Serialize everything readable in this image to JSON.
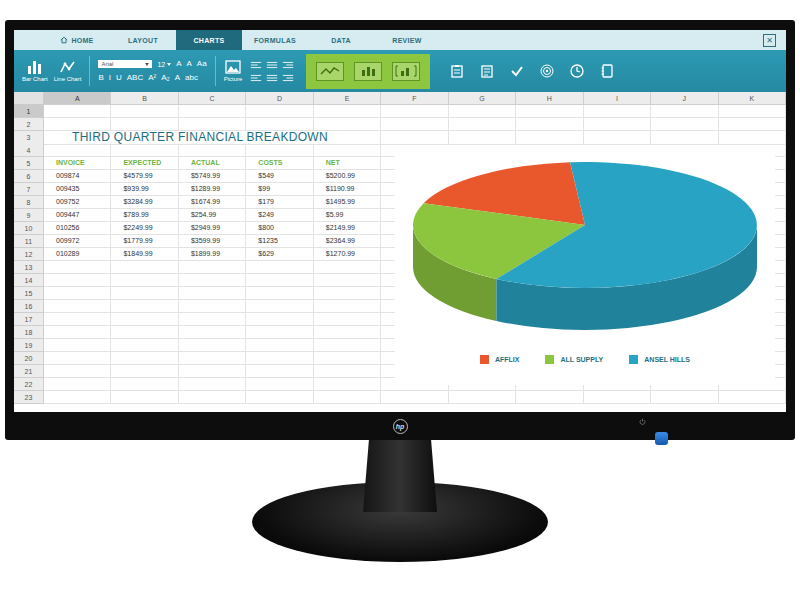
{
  "tabs": [
    {
      "label": "HOME",
      "selected": false
    },
    {
      "label": "LAYOUT",
      "selected": false
    },
    {
      "label": "CHARTS",
      "selected": true
    },
    {
      "label": "FORMULAS",
      "selected": false
    },
    {
      "label": "DATA",
      "selected": false
    },
    {
      "label": "REVIEW",
      "selected": false
    }
  ],
  "close": "✕",
  "ribbon": {
    "chart_buttons": [
      {
        "label": "Bar Chart"
      },
      {
        "label": "Line Chart"
      }
    ],
    "font": {
      "family": "Arial",
      "size": "12",
      "row1": [
        "A",
        "A",
        "Aa"
      ],
      "row2": [
        "B",
        "I",
        "U",
        "ABC",
        "A²",
        "A₂",
        "A",
        "abc"
      ]
    },
    "picture": {
      "label": "Picture"
    }
  },
  "sheet": {
    "columns": [
      {
        "label": "A",
        "selected": true
      },
      {
        "label": "B",
        "selected": false
      },
      {
        "label": "C",
        "selected": false
      },
      {
        "label": "D",
        "selected": false
      },
      {
        "label": "E",
        "selected": false
      },
      {
        "label": "F",
        "selected": false
      },
      {
        "label": "G",
        "selected": false
      },
      {
        "label": "H",
        "selected": false
      },
      {
        "label": "I",
        "selected": false
      },
      {
        "label": "J",
        "selected": false
      },
      {
        "label": "K",
        "selected": false
      }
    ],
    "rows": [
      {
        "label": "1",
        "selected": true
      },
      {
        "label": "2",
        "selected": false
      },
      {
        "label": "3",
        "selected": false
      },
      {
        "label": "4",
        "selected": false
      },
      {
        "label": "5",
        "selected": false
      },
      {
        "label": "6",
        "selected": false
      },
      {
        "label": "7",
        "selected": false
      },
      {
        "label": "8",
        "selected": false
      },
      {
        "label": "9",
        "selected": false
      },
      {
        "label": "10",
        "selected": false
      },
      {
        "label": "11",
        "selected": false
      },
      {
        "label": "12",
        "selected": false
      },
      {
        "label": "13",
        "selected": false
      },
      {
        "label": "14",
        "selected": false
      },
      {
        "label": "15",
        "selected": false
      },
      {
        "label": "16",
        "selected": false
      },
      {
        "label": "17",
        "selected": false
      },
      {
        "label": "18",
        "selected": false
      },
      {
        "label": "19",
        "selected": false
      },
      {
        "label": "20",
        "selected": false
      },
      {
        "label": "21",
        "selected": false
      },
      {
        "label": "22",
        "selected": false
      },
      {
        "label": "23",
        "selected": false
      }
    ],
    "title": "THIRD QUARTER FINANCIAL BREAKDOWN",
    "headers": [
      "INVOICE",
      "EXPECTED",
      "ACTUAL",
      "COSTS",
      "NET"
    ],
    "records": [
      [
        "009874",
        "$4579.99",
        "$5749.99",
        "$549",
        "$5200.99"
      ],
      [
        "009435",
        "$939.99",
        "$1289.99",
        "$99",
        "$1190.99"
      ],
      [
        "009752",
        "$3284.99",
        "$1674.99",
        "$179",
        "$1495.99"
      ],
      [
        "009447",
        "$789.99",
        "$254.99",
        "$249",
        "$5.99"
      ],
      [
        "010256",
        "$2249.99",
        "$2949.99",
        "$800",
        "$2149.99"
      ],
      [
        "009972",
        "$1779.99",
        "$3599.99",
        "$1235",
        "$2364.99"
      ],
      [
        "010289",
        "$1849.99",
        "$1899.99",
        "$629",
        "$1270.99"
      ]
    ]
  },
  "chart": {
    "slices": [
      {
        "label": "AFFLIX",
        "value": 18,
        "color": "#e9582c"
      },
      {
        "label": "ALL SUPPLY",
        "value": 22,
        "color": "#8cc63e"
      },
      {
        "label": "ANSEL HILLS",
        "value": 60,
        "color": "#29a3c3"
      }
    ]
  },
  "monitor": {
    "logo": "hp"
  }
}
